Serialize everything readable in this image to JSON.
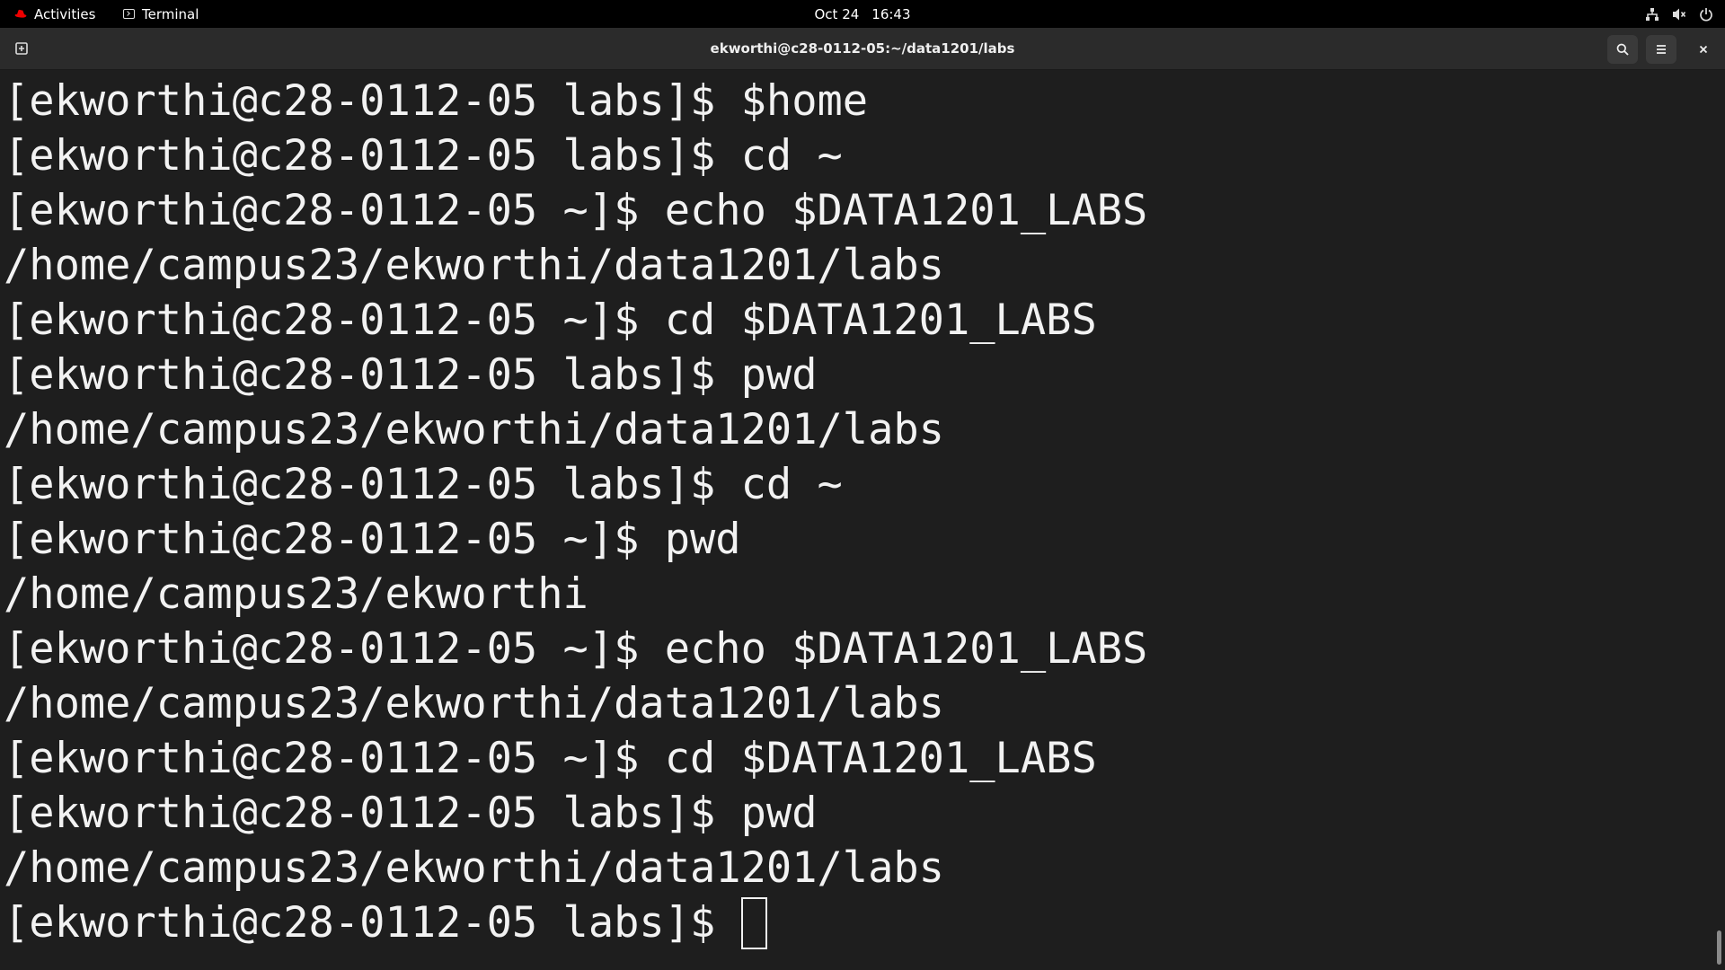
{
  "topbar": {
    "activities": "Activities",
    "app_name": "Terminal",
    "date": "Oct 24",
    "time": "16:43",
    "status_icons": [
      "network-icon",
      "volume-icon",
      "power-icon"
    ]
  },
  "window": {
    "title": "ekworthi@c28-0112-05:~/data1201/labs"
  },
  "terminal": {
    "lines": [
      "[ekworthi@c28-0112-05 labs]$ $home",
      "[ekworthi@c28-0112-05 labs]$ cd ~",
      "[ekworthi@c28-0112-05 ~]$ echo $DATA1201_LABS",
      "/home/campus23/ekworthi/data1201/labs",
      "[ekworthi@c28-0112-05 ~]$ cd $DATA1201_LABS",
      "[ekworthi@c28-0112-05 labs]$ pwd",
      "/home/campus23/ekworthi/data1201/labs",
      "[ekworthi@c28-0112-05 labs]$ cd ~",
      "[ekworthi@c28-0112-05 ~]$ pwd",
      "/home/campus23/ekworthi",
      "[ekworthi@c28-0112-05 ~]$ echo $DATA1201_LABS",
      "/home/campus23/ekworthi/data1201/labs",
      "[ekworthi@c28-0112-05 ~]$ cd $DATA1201_LABS",
      "[ekworthi@c28-0112-05 labs]$ pwd",
      "/home/campus23/ekworthi/data1201/labs"
    ],
    "current_prompt": "[ekworthi@c28-0112-05 labs]$ "
  },
  "colors": {
    "background": "#1e1e1e",
    "foreground": "#f2f2f2",
    "topbar": "#000000",
    "headerbar": "#2b2b2b",
    "redhat": "#ee0000"
  }
}
